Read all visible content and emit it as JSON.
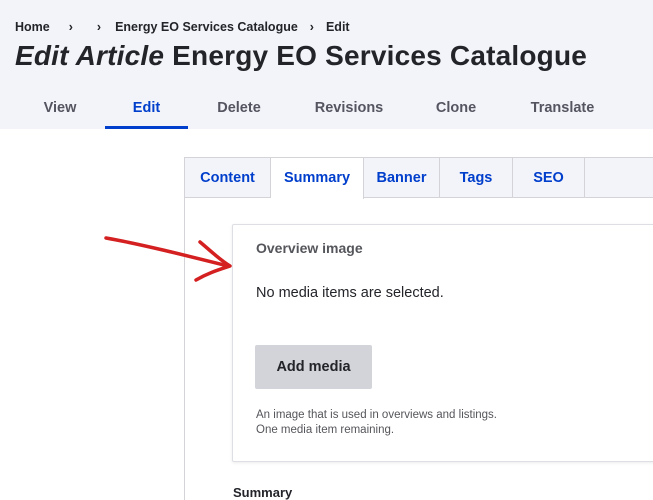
{
  "breadcrumb": {
    "home": "Home",
    "sep1": "›",
    "sep2": "›",
    "item2": "Energy EO Services Catalogue",
    "sep3": "›",
    "current": "Edit"
  },
  "page": {
    "title_prefix": "Edit Article",
    "title": "Energy EO Services Catalogue"
  },
  "primary_tabs": [
    {
      "label": "View",
      "active": false
    },
    {
      "label": "Edit",
      "active": true
    },
    {
      "label": "Delete",
      "active": false
    },
    {
      "label": "Revisions",
      "active": false
    },
    {
      "label": "Clone",
      "active": false
    },
    {
      "label": "Translate",
      "active": false
    }
  ],
  "vertical_tabs": [
    {
      "label": "Content",
      "active": false
    },
    {
      "label": "Summary",
      "active": true
    },
    {
      "label": "Banner",
      "active": false
    },
    {
      "label": "Tags",
      "active": false
    },
    {
      "label": "SEO",
      "active": false
    }
  ],
  "overview_image": {
    "title": "Overview image",
    "empty_message": "No media items are selected.",
    "add_button": "Add media",
    "help_line1": "An image that is used in overviews and listings.",
    "help_line2": "One media item remaining."
  },
  "summary_field": {
    "label": "Summary"
  },
  "colors": {
    "accent": "#003ecc",
    "header_bg": "#f3f4f9",
    "annotation_arrow": "#d42020",
    "button_bg": "#d3d4d9"
  },
  "icons": {
    "annotation": "red-arrow-annotation"
  }
}
